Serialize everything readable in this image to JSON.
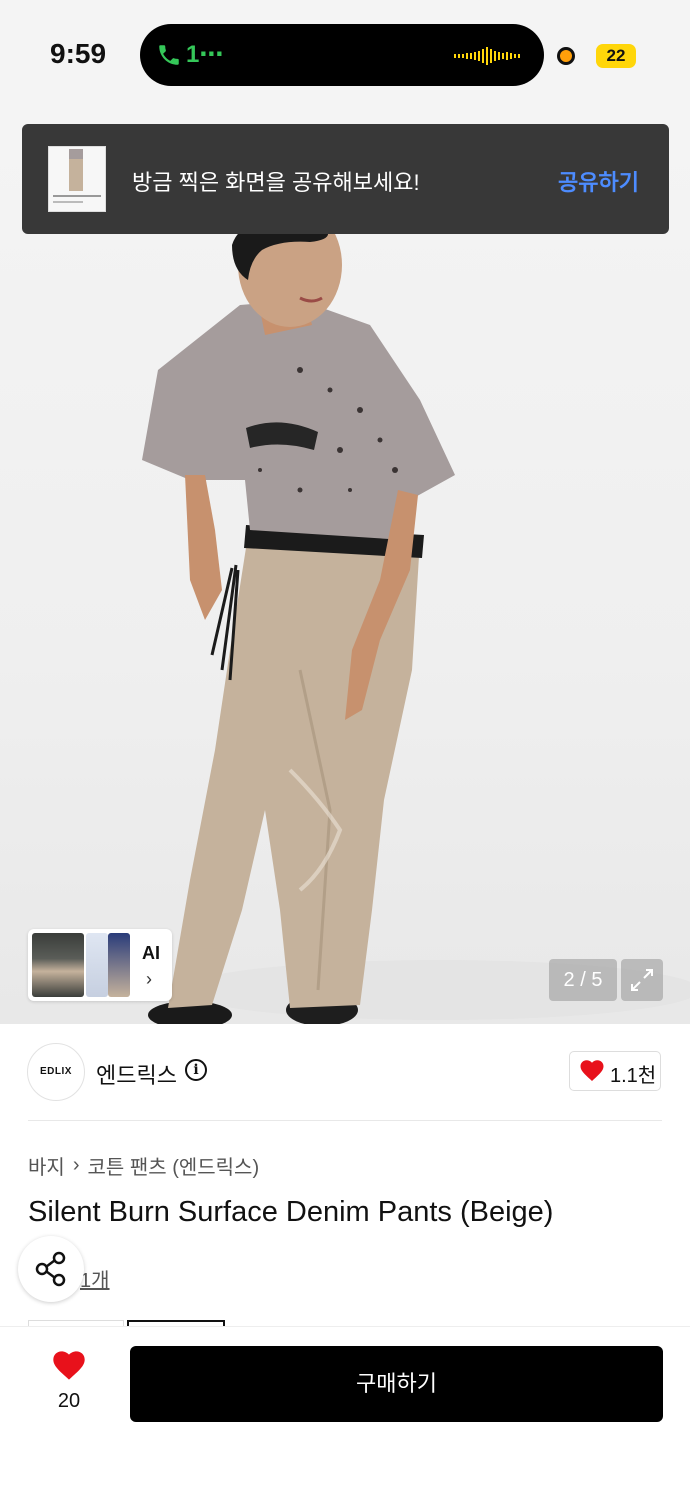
{
  "status_bar": {
    "time": "9:59",
    "call_text": "1⋯",
    "battery": "22"
  },
  "toast": {
    "message": "방금 찍은 화면을 공유해보세요!",
    "action": "공유하기"
  },
  "gallery": {
    "ai_label": "AI",
    "ai_chevron": "›",
    "counter": "2 / 5",
    "total_images": 5,
    "current_image": 2
  },
  "brand": {
    "logo_text": "EDLIX",
    "name": "엔드릭스",
    "like_count": "1.1천"
  },
  "breadcrumb": {
    "category": "바지",
    "separator": "›",
    "subcategory": "코튼 팬츠 (엔드릭스)"
  },
  "product": {
    "title": "Silent Burn Surface Denim Pants (Beige)",
    "review_text": "1개"
  },
  "bottom_bar": {
    "wish_count": "20",
    "buy_label": "구매하기"
  },
  "colors": {
    "accent_link": "#4d8cff",
    "heart": "#e8111b",
    "call_green": "#35c759",
    "battery": "#ffd60a"
  }
}
